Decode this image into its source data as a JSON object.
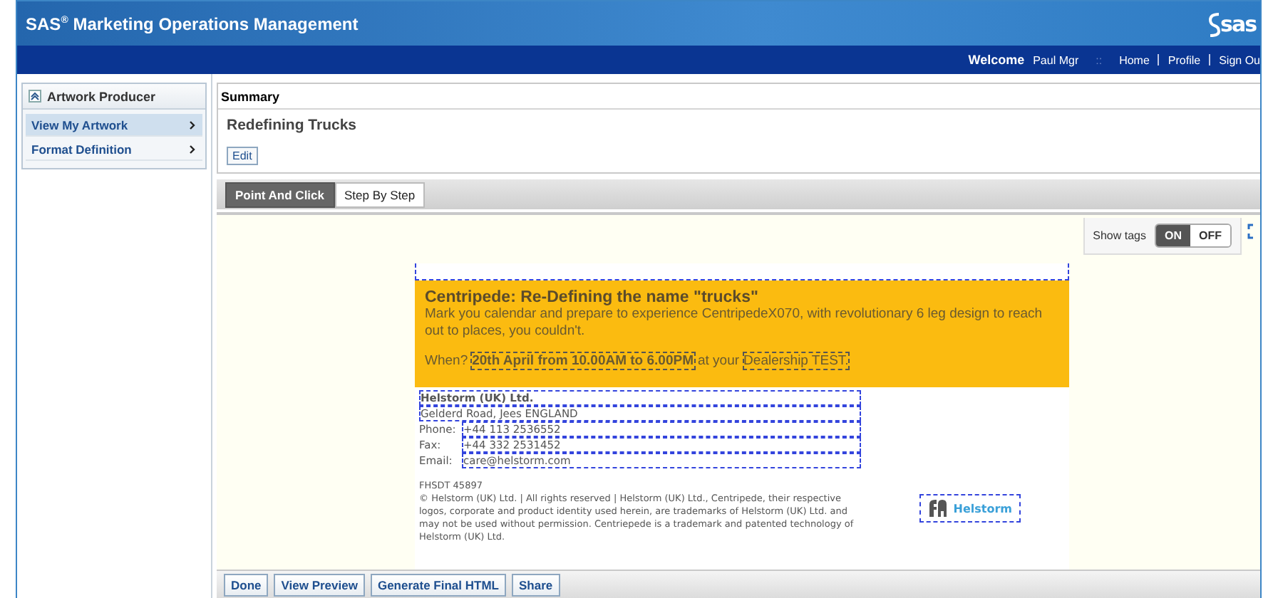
{
  "header": {
    "title": "SAS$^{®}$ Marketing Operations Management",
    "logo": "sas"
  },
  "userbar": {
    "welcome": "Welcome",
    "user": "Paul Mgr",
    "separator": "::",
    "links": [
      "Home",
      "Profile",
      "Sign Ou"
    ]
  },
  "sidebar": {
    "title": "Artwork Producer",
    "items": [
      {
        "label": "View My Artwork",
        "selected": true
      },
      {
        "label": "Format Definition",
        "selected": false
      }
    ]
  },
  "summary": {
    "heading": "Summary",
    "title": "Redefining Trucks",
    "edit_button": "Edit"
  },
  "tabs": [
    {
      "label": "Point And Click",
      "selected": true
    },
    {
      "label": "Step By Step",
      "selected": false
    }
  ],
  "show_tags": {
    "label": "Show tags",
    "on_label": "ON",
    "off_label": "OFF",
    "on": true
  },
  "email": {
    "headline": "Centripede: Re-Defining the name \"trucks\"",
    "body": "Mark you calendar and prepare to experience CentripedeX070, with revolutionary 6 leg design to reach out to places, you couldn't.",
    "when_label": "When?",
    "when_date": "20th April from 10.00AM to 6.00PM",
    "at_label": "at your",
    "location": "Dealership TEST.",
    "company": "Helstorm (UK) Ltd.",
    "address": "Gelderd Road, Jees ENGLAND",
    "contacts": [
      {
        "label": "Phone:",
        "value": "+44 113 2536552"
      },
      {
        "label": "Fax:",
        "value": "+44 332 2531452"
      },
      {
        "label": "Email:",
        "value": "care@helstorm.com"
      }
    ],
    "code": "FHSDT 45897",
    "legal": "© Helstorm (UK) Ltd. | All rights reserved | Helstorm (UK) Ltd., Centripede, their respective logos, corporate and product identity used herein, are trademarks of Helstorm (UK) Ltd. and may not be used without permission. Centriepede is a trademark and patented technology of Helstorm (UK) Ltd.",
    "logo_text": "Helstorm"
  },
  "buttons": [
    "Done",
    "View Preview",
    "Generate Final HTML",
    "Share"
  ]
}
